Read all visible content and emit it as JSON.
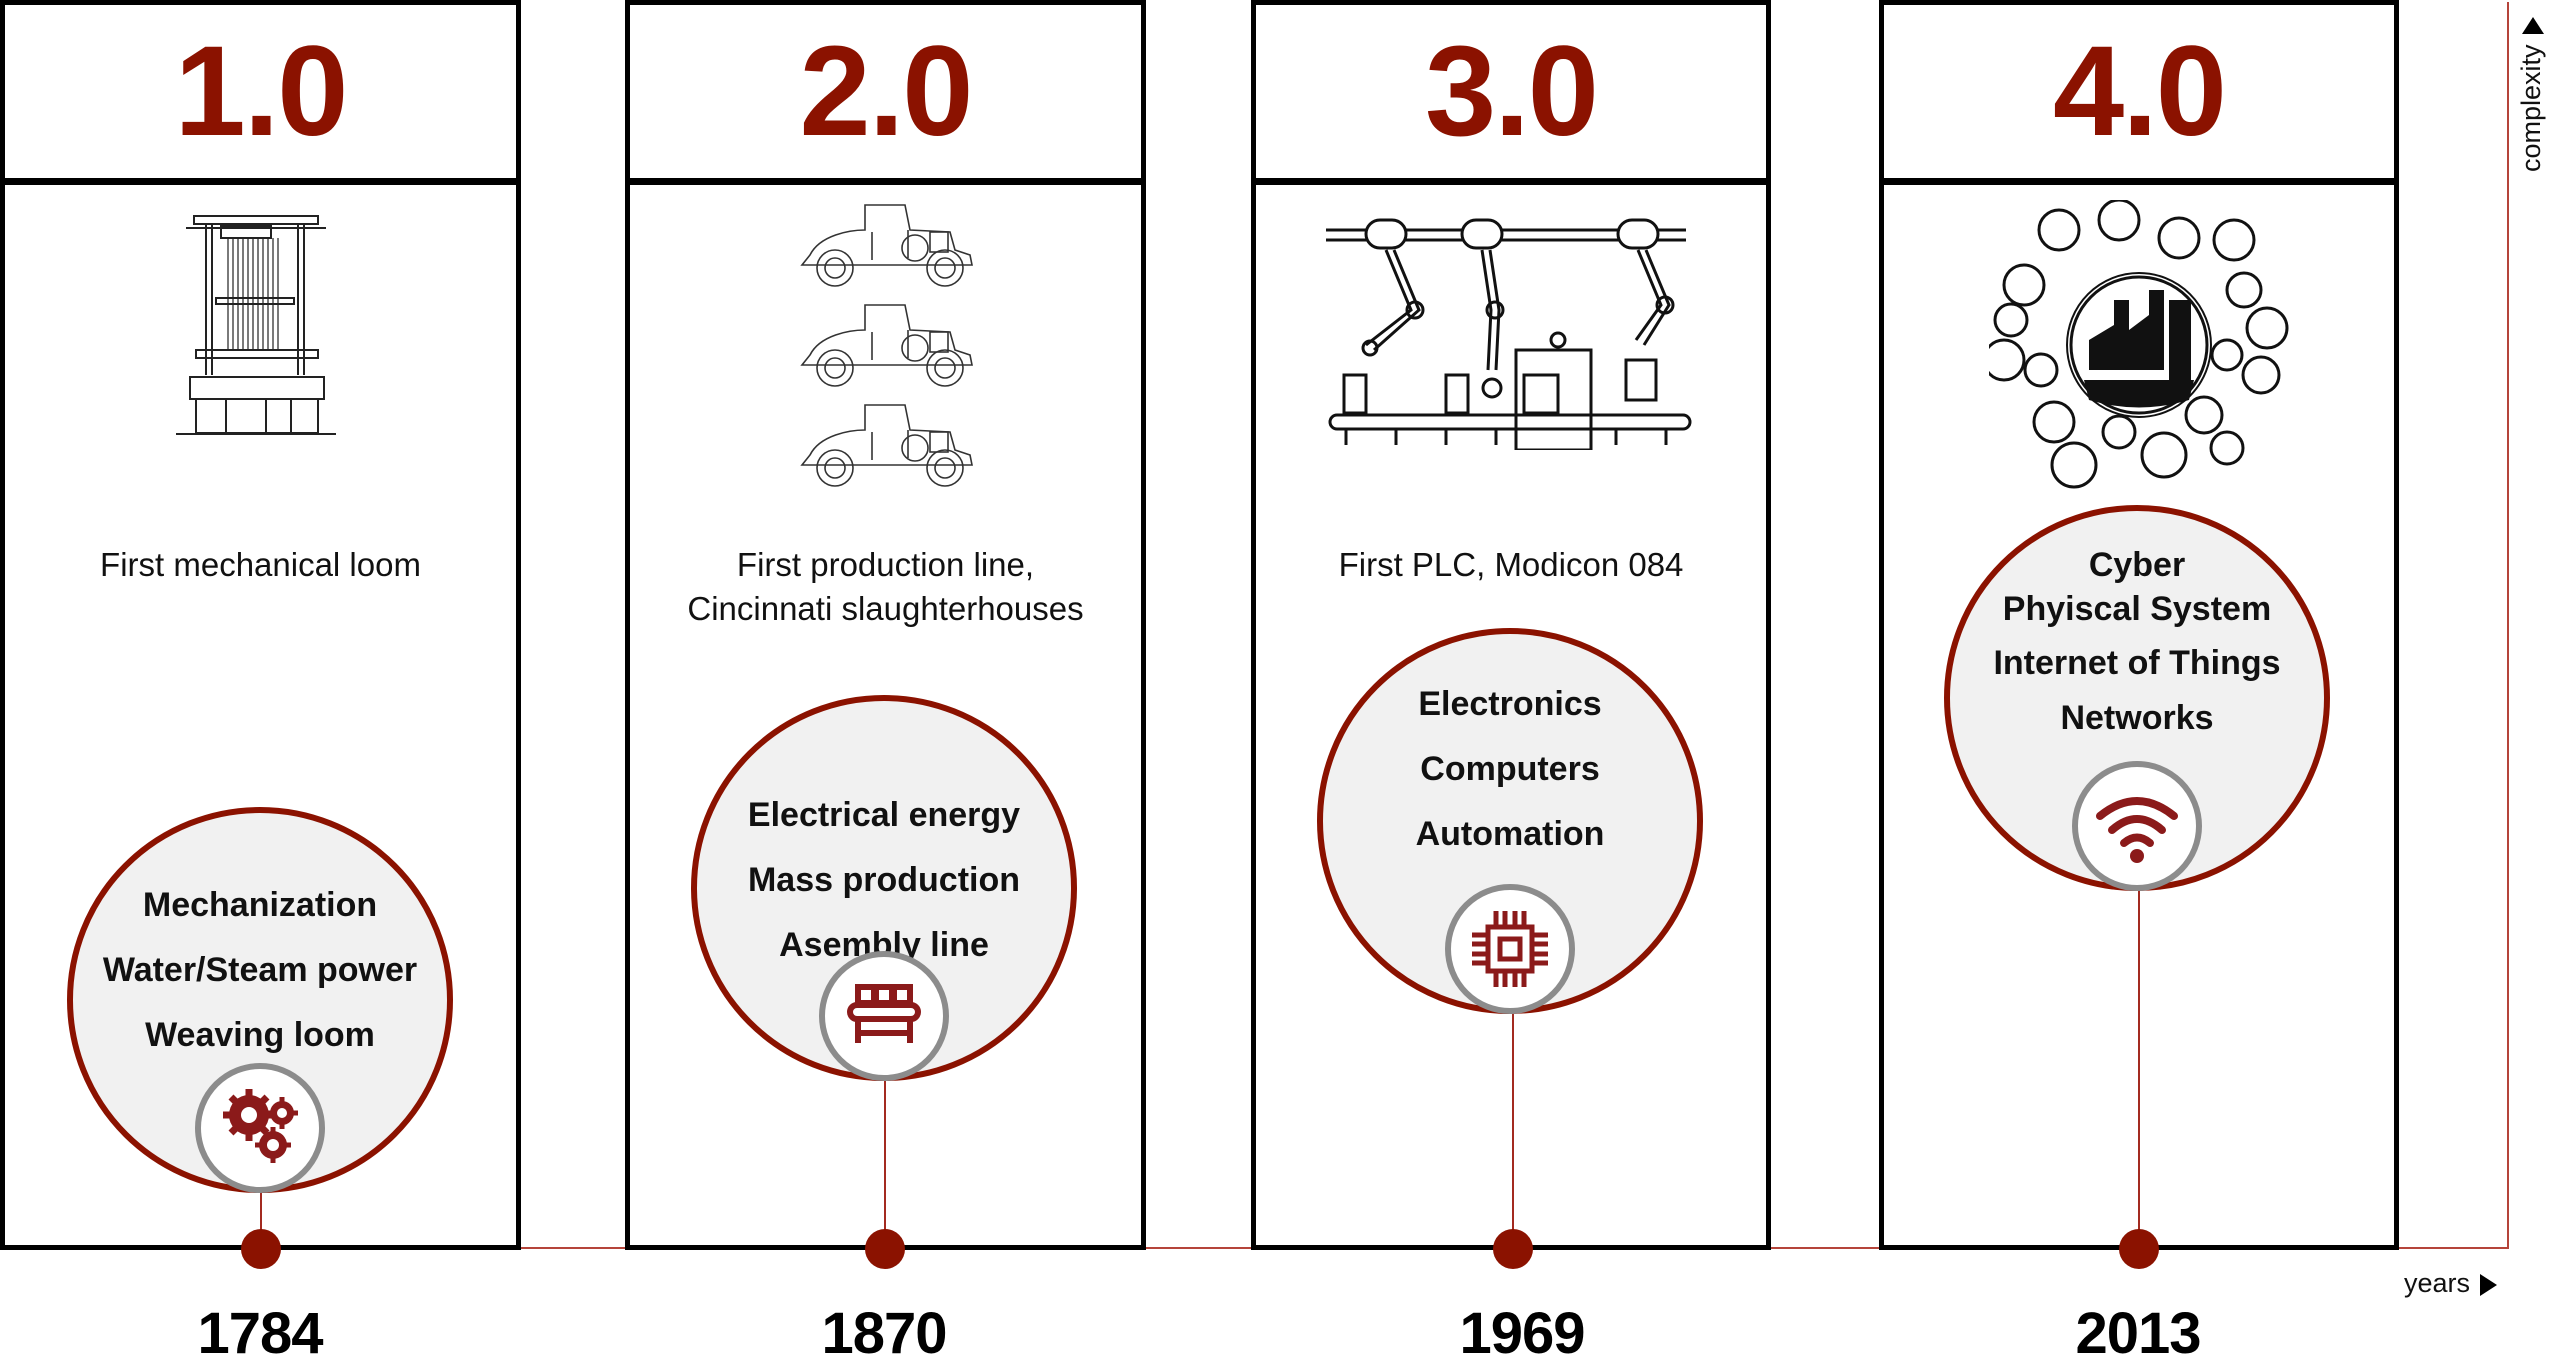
{
  "colors": {
    "accent": "#8b1200",
    "timeline": "#b5443a",
    "badge_ring": "#8c8c8c",
    "bubble_fill": "#f1f1f1",
    "border": "#000000"
  },
  "axes": {
    "x_label": "years",
    "y_label": "complexity"
  },
  "eras": [
    {
      "version": "1.0",
      "illustration": "mechanical-loom-drawing",
      "description": [
        "First mechanical loom"
      ],
      "bubble": [
        "Mechanization",
        "Water/Steam power",
        "Weaving loom"
      ],
      "badge_icon": "gears-icon",
      "year": "1784"
    },
    {
      "version": "2.0",
      "illustration": "vintage-cars-production-line-drawing",
      "description": [
        "First production line,",
        "Cincinnati slaughterhouses"
      ],
      "bubble": [
        "Electrical energy",
        "Mass production",
        "Asembly line"
      ],
      "badge_icon": "conveyor-belt-icon",
      "year": "1870"
    },
    {
      "version": "3.0",
      "illustration": "robotic-arms-assembly-line-drawing",
      "description": [
        "First PLC, Modicon 084"
      ],
      "bubble": [
        "Electronics",
        "Computers",
        "Automation"
      ],
      "badge_icon": "microchip-icon",
      "year": "1969"
    },
    {
      "version": "4.0",
      "illustration": "smart-factory-network-drawing",
      "description": [],
      "bubble": [
        "Cyber",
        "Phyiscal System",
        "Internet of Things",
        "Networks"
      ],
      "badge_icon": "wifi-icon",
      "year": "2013"
    }
  ]
}
